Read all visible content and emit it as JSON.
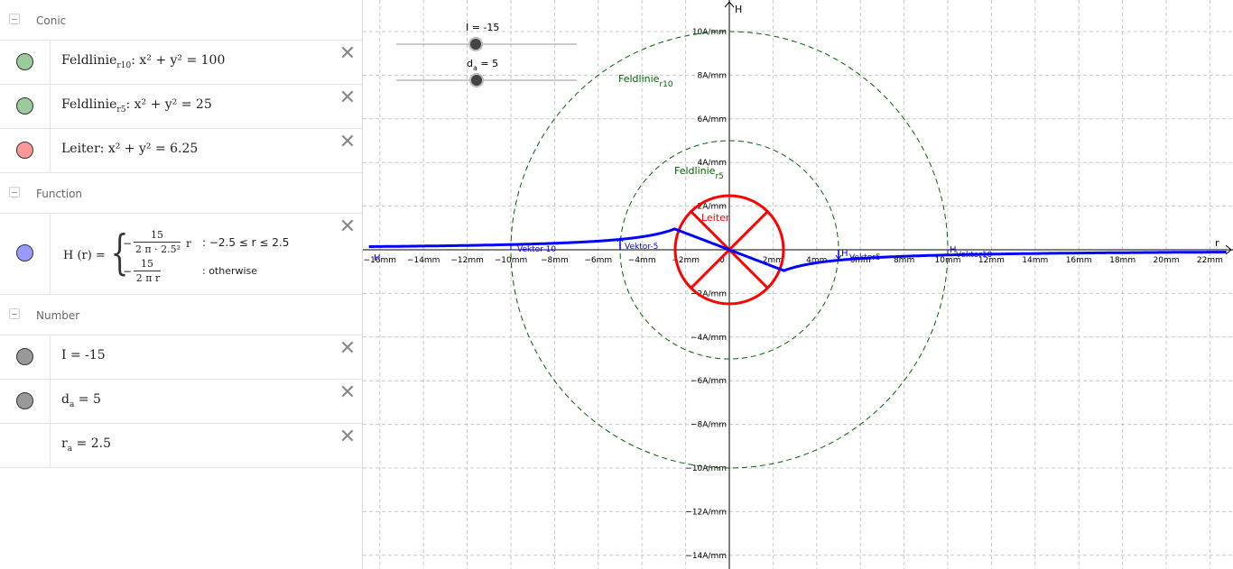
{
  "algebra": {
    "categories": {
      "conic": "Conic",
      "function": "Function",
      "number": "Number"
    },
    "items": {
      "feld10": {
        "name": "Feldlinie",
        "sub": "r10",
        "expr": ": x² + y² = 100",
        "color": "#99cc99"
      },
      "feld5": {
        "name": "Feldlinie",
        "sub": "r5",
        "expr": ": x² + y² = 25",
        "color": "#99cc99"
      },
      "leiter": {
        "expr": "Leiter: x² + y² = 6.25",
        "color": "#ff9999"
      },
      "h": {
        "lhs": "H (r) =",
        "c1_num": "15",
        "c1_den": "2 π · 2.5²",
        "c1_var": "r",
        "c1_cond": ": −2.5 ≤ r ≤ 2.5",
        "c2_num": "15",
        "c2_den": "2 π r",
        "c2_cond": ": otherwise",
        "minus": "−",
        "color": "#9999ff"
      },
      "I": {
        "expr": "I = -15",
        "color": "#999999"
      },
      "da": {
        "name": "d",
        "sub": "a",
        "expr": " = 5",
        "color": "#999999"
      },
      "ra": {
        "name": "r",
        "sub": "a",
        "expr": " = 2.5"
      }
    },
    "delete_glyph": "✕"
  },
  "graph": {
    "x_axis_label": "r",
    "y_axis_label": "H",
    "x_ticks": [
      "−16mm",
      "−14mm",
      "−12mm",
      "−10mm",
      "−8mm",
      "−6mm",
      "−4mm",
      "−2mm",
      "0",
      "2mm",
      "4mm",
      "6mm",
      "8mm",
      "10mm",
      "12mm",
      "14mm",
      "16mm",
      "18mm",
      "20mm",
      "22mm"
    ],
    "y_ticks": [
      "10A/mm",
      "8A/mm",
      "6A/mm",
      "4A/mm",
      "2A/mm",
      "−2A/mm",
      "−4A/mm",
      "−6A/mm",
      "−8A/mm",
      "−10A/mm",
      "−12A/mm",
      "−14A/mm"
    ],
    "x_tick_values": [
      -16,
      -14,
      -12,
      -10,
      -8,
      -6,
      -4,
      -2,
      0,
      2,
      4,
      6,
      8,
      10,
      12,
      14,
      16,
      18,
      20,
      22
    ],
    "y_tick_values": [
      10,
      8,
      6,
      4,
      2,
      -2,
      -4,
      -6,
      -8,
      -10,
      -12,
      -14
    ],
    "labels": {
      "feld10": "Feldlinie",
      "feld10_sub": "r10",
      "feld5": "Feldlinie",
      "feld5_sub": "r5",
      "leiter": "Leiter",
      "vek_m10": "Vektor-10",
      "vek_m5": "Vektor-5",
      "vek_5": "Vektor5",
      "vek_10": "Vektor10",
      "h_m10": "H",
      "h_5": "H",
      "h_10": "H"
    },
    "sliders": {
      "I": {
        "label": "I = -15",
        "value": -15
      },
      "da": {
        "label_name": "d",
        "label_sub": "a",
        "label_val": " = 5",
        "value": 5
      }
    },
    "colors": {
      "function": "#0000ff",
      "conductor": "#ff0000",
      "field_line": "#006400",
      "grid": "#c0c0c0"
    }
  }
}
